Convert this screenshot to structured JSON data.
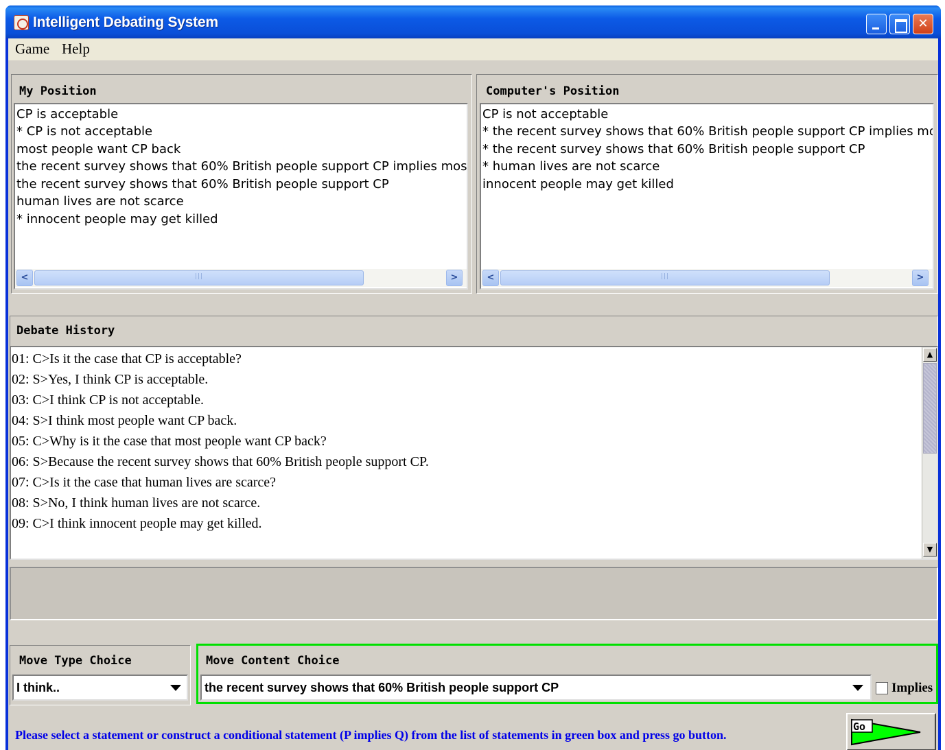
{
  "window": {
    "title": "Intelligent Debating System"
  },
  "menu": [
    "Game",
    "Help"
  ],
  "my_position": {
    "header": "My Position",
    "items": [
      " CP is acceptable",
      "* CP is not acceptable",
      " most people want CP back",
      " the recent survey shows that 60% British people support CP implies most pe",
      " the recent survey shows that 60% British people support CP",
      " human lives are not scarce",
      "* innocent people may get killed"
    ]
  },
  "computer_position": {
    "header": "Computer's Position",
    "items": [
      " CP is not acceptable",
      "* the recent survey shows that 60% British people support CP implies most pe",
      "* the recent survey shows that 60% British people support CP",
      "* human lives are not scarce",
      " innocent people may get killed"
    ]
  },
  "debate_history": {
    "header": "Debate History",
    "lines": [
      "01: C>Is it the case that CP is acceptable?",
      "02: S>Yes, I think CP is acceptable.",
      "03: C>I think CP is not acceptable.",
      "04: S>I think most people want CP back.",
      "05: C>Why is it the case that most people want CP back?",
      "06: S>Because the recent survey shows that 60% British people support CP.",
      "07: C>Is it the case that human lives are scarce?",
      "08: S>No, I think human lives are not scarce.",
      "09: C>I think innocent people may get killed."
    ]
  },
  "move_type": {
    "header": "Move Type Choice",
    "selected": "I think.."
  },
  "move_content": {
    "header": "Move Content Choice",
    "selected": "the recent survey shows that 60% British people support CP",
    "implies_label": "Implies",
    "implies_checked": false
  },
  "instruction": "Please select a statement or construct a conditional statement (P implies Q) from the list of statements in green box and press go button.",
  "go_button": {
    "label": "Go",
    "color": "#00ff00"
  },
  "colors": {
    "titlebar": "#0a4fd8",
    "panel": "#d4d0c8",
    "highlight": "#00e000",
    "instruction": "#0000e8"
  }
}
